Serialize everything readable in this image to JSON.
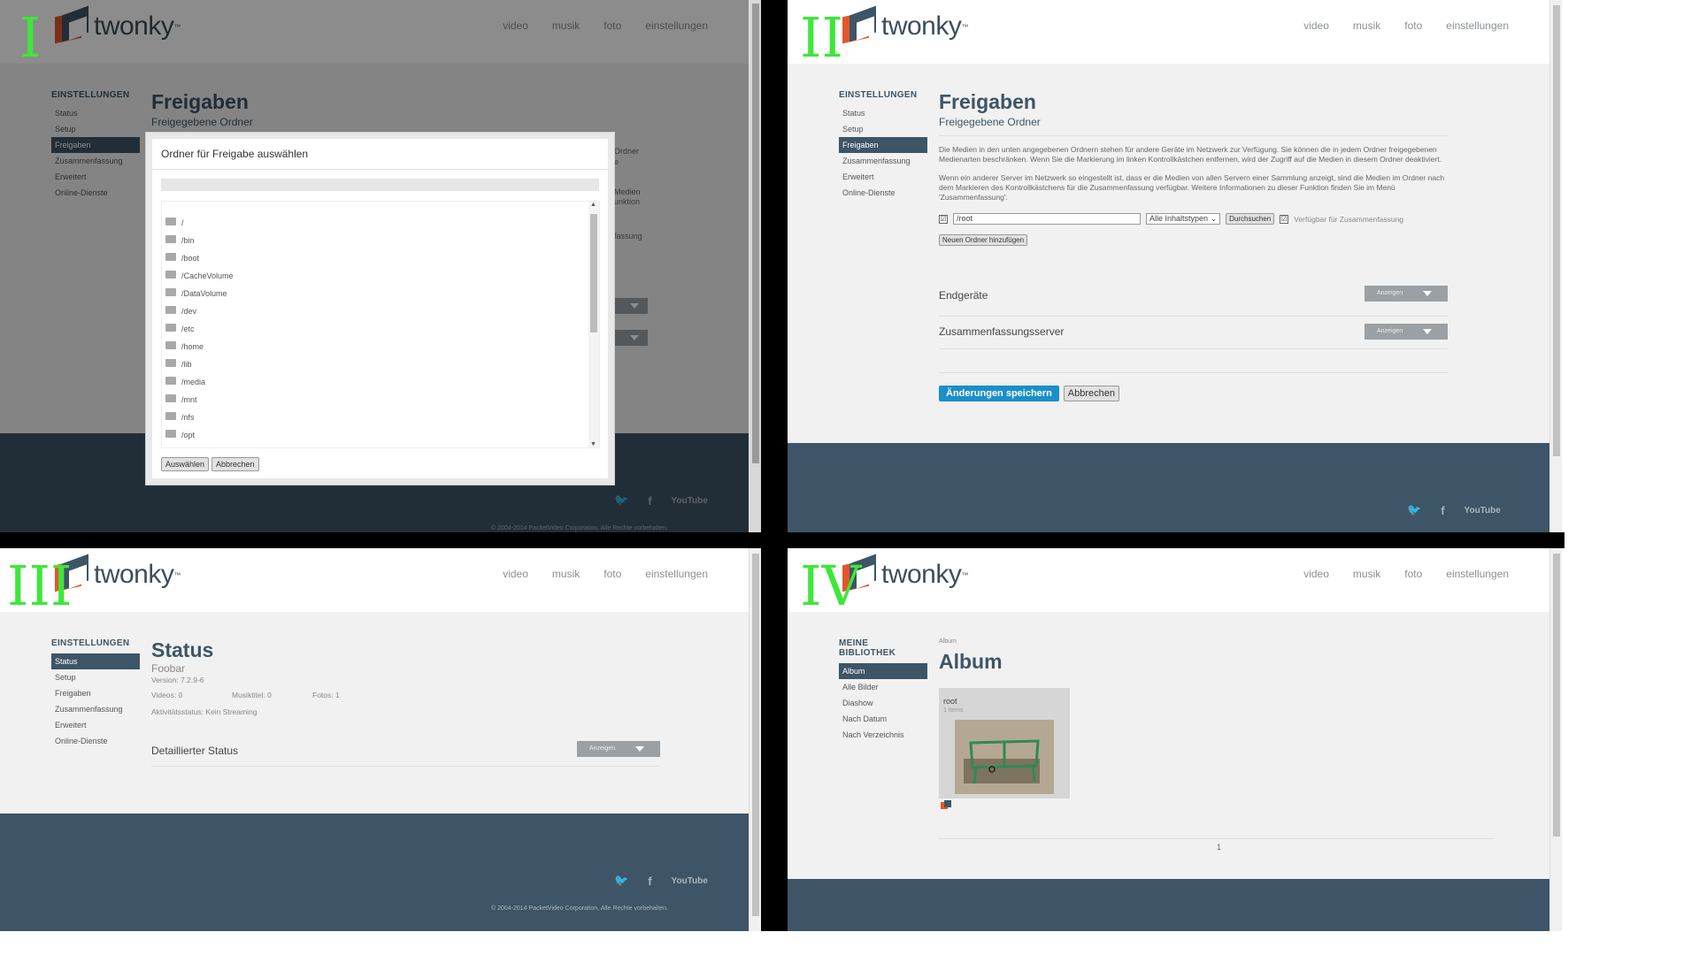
{
  "logo": {
    "text": "twonky",
    "tm": "™"
  },
  "nav": {
    "video": "video",
    "music": "musik",
    "photo": "foto",
    "settings": "einstellungen"
  },
  "settings_menu": {
    "title": "EINSTELLUNGEN",
    "items": [
      "Status",
      "Setup",
      "Freigaben",
      "Zusammenfassung",
      "Erweitert",
      "Online-Dienste"
    ]
  },
  "library_menu": {
    "title": "MEINE BIBLIOTHEK",
    "items": [
      "Album",
      "Alle Bilder",
      "Diashow",
      "Nach Datum",
      "Nach Verzeichnis"
    ]
  },
  "quadrants": {
    "q1": {
      "label": "I"
    },
    "q2": {
      "label": "II"
    },
    "q3": {
      "label": "III"
    },
    "q4": {
      "label": "IV"
    }
  },
  "sharing": {
    "title": "Freigaben",
    "subtitle": "Freigegebene Ordner",
    "para1": "Die Medien in den unten angegebenen Ordnern stehen für andere Geräte im Netzwerk zur Verfügung. Sie können die in jedem Ordner freigegebenen Medienarten beschränken. Wenn Sie die Markierung im linken Kontrollkästchen entfernen, wird der Zugriff auf die Medien in diesem Ordner deaktiviert.",
    "para2": "Wenn ein anderer Server im Netzwerk so eingestellt ist, dass er die Medien von allen Servern einer Sammlung anzeigt, sind die Medien im Ordner nach dem Markieren des Kontrollkästchens für die Zusammenfassung verfügbar. Weitere Informationen zu dieser Funktion finden Sie im Menü 'Zusammenfassung'.",
    "folder_value": "/root",
    "content_type": "Alle Inhaltstypen",
    "browse": "Durchsuchen",
    "aggregation_label": "Verfügbar für Zusammenfassung",
    "add_folder": "Neuen Ordner hinzufügen",
    "devices_label": "Endgeräte",
    "aggregation_server_label": "Zusammenfassungsserver",
    "show": "Anzeigen",
    "save": "Änderungen speichern",
    "cancel": "Abbrechen"
  },
  "partial_bg": {
    "line1": "Ordner",
    "line2": "e",
    "line3": "Medien",
    "line4": "unktion",
    "line5": "fassung"
  },
  "modal": {
    "title": "Ordner für Freigabe auswählen",
    "folders": [
      "/",
      "/bin",
      "/boot",
      "/CacheVolume",
      "/DataVolume",
      "/dev",
      "/etc",
      "/home",
      "/lib",
      "/media",
      "/mnt",
      "/nfs",
      "/opt"
    ],
    "select": "Auswählen",
    "cancel": "Abbrechen"
  },
  "status": {
    "title": "Status",
    "server_name": "Foobar",
    "version": "Version: 7.2.9-6",
    "videos": "Videos: 0",
    "music": "Musiktitel: 0",
    "photos": "Fotos: 1",
    "activity": "Aktivitätsstatus: Kein Streaming",
    "detailed": "Detaillierter Status",
    "show": "Anzeigen"
  },
  "album": {
    "breadcrumb": "Album",
    "title": "Album",
    "card_title": "root",
    "card_count": "1 items",
    "page": "1"
  },
  "footer": {
    "youtube": "YouTube",
    "copyright": "© 2004-2014 PacketVideo Corporation. Alle Rechte vorbehalten."
  }
}
